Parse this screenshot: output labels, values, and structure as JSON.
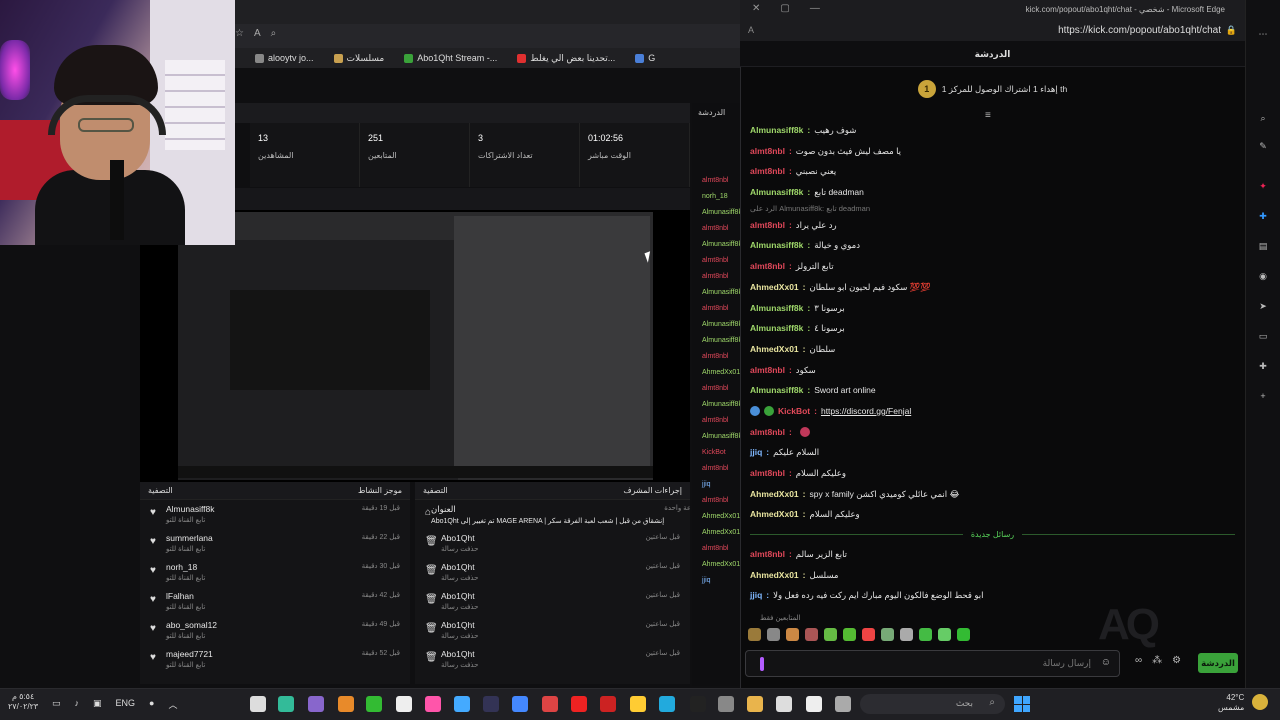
{
  "background_browser": {
    "favorites": [
      {
        "label": "alooytv jo...",
        "color": "#888888"
      },
      {
        "label": "مسلسلات",
        "color": "#c8a050"
      },
      {
        "label": "Abo1Qht Stream -...",
        "color": "#3aa23a"
      },
      {
        "label": "تحدينا بعض الي يغلط...",
        "color": "#e03030"
      },
      {
        "label": "G",
        "color": "#4a7fd8"
      }
    ]
  },
  "dashboard": {
    "stats": [
      {
        "value": "13",
        "label": "المشاهدين"
      },
      {
        "value": "251",
        "label": "المتابعين"
      },
      {
        "value": "3",
        "label": "تعداد الاشتراكات"
      },
      {
        "value": "01:02:56",
        "label": "الوقت مباشر"
      }
    ],
    "side_chat_title": "الدردشة",
    "side_chat_users": [
      {
        "name": "almt8nbl",
        "color": "#e0485a"
      },
      {
        "name": "norh_18",
        "color": "#9fd86a"
      },
      {
        "name": "Almunasiff8k",
        "color": "#9fd86a"
      },
      {
        "name": "almt8nbl",
        "color": "#e0485a"
      },
      {
        "name": "Almunasiff8k",
        "color": "#9fd86a"
      },
      {
        "name": "almt8nbl",
        "color": "#e0485a"
      },
      {
        "name": "almt8nbl",
        "color": "#e0485a"
      },
      {
        "name": "Almunasiff8k",
        "color": "#9fd86a"
      },
      {
        "name": "almt8nbl",
        "color": "#e0485a"
      },
      {
        "name": "Almunasiff8k",
        "color": "#9fd86a"
      },
      {
        "name": "Almunasiff8k",
        "color": "#9fd86a"
      },
      {
        "name": "almt8nbl",
        "color": "#e0485a"
      },
      {
        "name": "AhmedXx01",
        "color": "#9fd86a"
      },
      {
        "name": "almt8nbl",
        "color": "#e0485a"
      },
      {
        "name": "Almunasiff8k",
        "color": "#9fd86a"
      },
      {
        "name": "almt8nbl",
        "color": "#e0485a"
      },
      {
        "name": "Almunasiff8k",
        "color": "#9fd86a"
      },
      {
        "name": "KickBot",
        "color": "#e0485a"
      },
      {
        "name": "almt8nbl",
        "color": "#e0485a"
      },
      {
        "name": "jjiq",
        "color": "#7fb8ff"
      },
      {
        "name": "almt8nbl",
        "color": "#e0485a"
      },
      {
        "name": "AhmedXx01",
        "color": "#9fd86a"
      },
      {
        "name": "AhmedXx01",
        "color": "#9fd86a"
      },
      {
        "name": "almt8nbl",
        "color": "#e0485a"
      },
      {
        "name": "AhmedXx01",
        "color": "#9fd86a"
      },
      {
        "name": "jjiq",
        "color": "#7fb8ff"
      }
    ],
    "flow_panel": {
      "title": "موجز النشاط",
      "filter": "التصفية",
      "items": [
        {
          "name": "Almunasiff8k",
          "sub": "تابع القناة للتو",
          "time": "قبل 19 دقيقة"
        },
        {
          "name": "summerlana",
          "sub": "تابع القناة للتو",
          "time": "قبل 22 دقيقة"
        },
        {
          "name": "norh_18",
          "sub": "تابع القناة للتو",
          "time": "قبل 30 دقيقة"
        },
        {
          "name": "lFalhan",
          "sub": "تابع القناة للتو",
          "time": "قبل 42 دقيقة"
        },
        {
          "name": "abo_somal12",
          "sub": "تابع القناة للتو",
          "time": "قبل 49 دقيقة"
        },
        {
          "name": "majeed7721",
          "sub": "تابع القناة للتو",
          "time": "قبل 52 دقيقة"
        }
      ]
    },
    "mod_panel": {
      "title": "إجراءات المشرف",
      "filter": "التصفية",
      "first": {
        "name": "العنوان",
        "sub": "Abo1Qht تم تغيير إلى MAGE ARENA | إنشقاق من قبل | شعب لعبة الفرقة سكر",
        "time": "قبل ساعة واحدة"
      },
      "items": [
        {
          "name": "Abo1Qht",
          "sub": "حذفت رسالة",
          "time": "قبل ساعتين"
        },
        {
          "name": "Abo1Qht",
          "sub": "حذفت رسالة",
          "time": "قبل ساعتين"
        },
        {
          "name": "Abo1Qht",
          "sub": "حذفت رسالة",
          "time": "قبل ساعتين"
        },
        {
          "name": "Abo1Qht",
          "sub": "حذفت رسالة",
          "time": "قبل ساعتين"
        },
        {
          "name": "Abo1Qht",
          "sub": "حذفت رسالة",
          "time": "قبل ساعتين"
        }
      ]
    }
  },
  "chat_window": {
    "window_title": "kick.com/popout/abo1qht/chat - شخصي - Microsoft Edge",
    "url": "https://kick.com/popout/abo1qht/chat",
    "header": "الدردشة",
    "pinned": "إهداء 1 اشتراك الوصول للمركز 1 th",
    "pinned_badge": "1",
    "messages": [
      {
        "user": "Almunasiff8k",
        "color": "green",
        "text": "شوف رهيب"
      },
      {
        "user": "almt8nbl",
        "color": "red",
        "text": "يا مصف ليش فيث بدون صوت"
      },
      {
        "user": "almt8nbl",
        "color": "red",
        "text": "يعني نصبني"
      },
      {
        "user": "Almunasiff8k",
        "color": "green",
        "text": "تابع deadman"
      },
      {
        "reply": "الرد على Almunasiff8k: تابع deadman"
      },
      {
        "user": "almt8nbl",
        "color": "red",
        "text": "رد علي يراد"
      },
      {
        "user": "Almunasiff8k",
        "color": "green",
        "text": "دموي و خيالة"
      },
      {
        "user": "almt8nbl",
        "color": "red",
        "text": "تابع الترولز"
      },
      {
        "user": "AhmedXx01",
        "color": "yellow",
        "text": "سكود فيم لحيون ابو سلطان 💯💯"
      },
      {
        "user": "Almunasiff8k",
        "color": "green",
        "text": "برسونا ٣"
      },
      {
        "user": "Almunasiff8k",
        "color": "green",
        "text": "برسونا ٤"
      },
      {
        "user": "AhmedXx01",
        "color": "yellow",
        "text": "سلطان"
      },
      {
        "user": "almt8nbl",
        "color": "red",
        "text": "سكود"
      },
      {
        "user": "Almunasiff8k",
        "color": "green",
        "text": "Sword art online"
      },
      {
        "user": "KickBot",
        "color": "bot",
        "text": "https://discord.gg/Fenjal",
        "link": true
      },
      {
        "user": "almt8nbl",
        "color": "red",
        "text": ""
      },
      {
        "user": "jjiq",
        "color": "blue",
        "text": "السلام عليكم"
      },
      {
        "user": "almt8nbl",
        "color": "red",
        "text": "وعليكم السلام"
      },
      {
        "user": "AhmedXx01",
        "color": "yellow",
        "text": "spy x family انمي عائلي كوميدي اكشن 😂"
      },
      {
        "user": "AhmedXx01",
        "color": "yellow",
        "text": "وعليكم السلام"
      }
    ],
    "new_messages_label": "رسائل جديدة",
    "new_messages": [
      {
        "user": "almt8nbl",
        "color": "red",
        "text": "تابع الزير سالم"
      },
      {
        "user": "AhmedXx01",
        "color": "yellow",
        "text": "مسلسل"
      },
      {
        "user": "jjiq",
        "color": "blue",
        "text": "ابو قحط الوضع فالكون اليوم مبارك ايم ركت فيه رده فعل ولا"
      }
    ],
    "mode_label": "المتابعين فقط",
    "input_placeholder": "إرسال رسالة",
    "send_label": "الدردشة"
  },
  "taskbar": {
    "clock_time": "٥:٥٤ م",
    "clock_date": "٢٧/٠٢/٢٣",
    "lang": "ENG",
    "search_placeholder": "بحث",
    "weather_temp": "42°C",
    "weather_desc": "مشمس"
  },
  "colors": {
    "green": "#9fd86a",
    "red": "#e0485a",
    "yellow": "#e9e5a0",
    "blue": "#7fb8ff",
    "bot": "#e24a5a",
    "accent": "#3aa23a"
  }
}
